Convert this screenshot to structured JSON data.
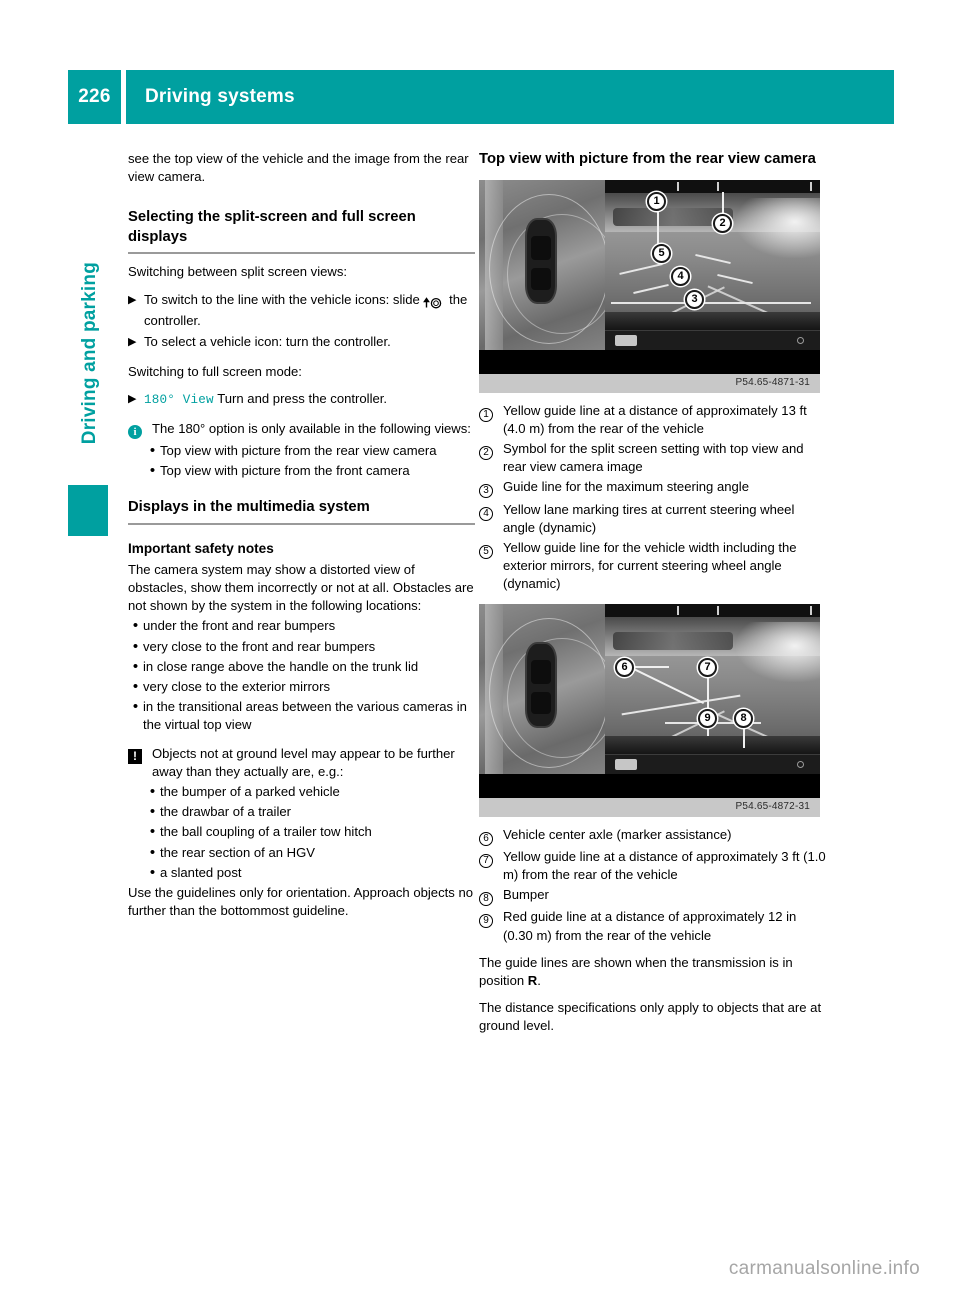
{
  "header": {
    "page_number": "226",
    "title": "Driving systems"
  },
  "side_tab": {
    "chapter_label": "Driving and parking"
  },
  "left_column": {
    "intro_paragraph": "see the top view of the vehicle and the image from the rear view camera.",
    "section1_heading": "Selecting the split-screen and full screen displays",
    "switching_split_label": "Switching between split screen views:",
    "steps": [
      {
        "marker": "▶",
        "text_before": "To switch to the line with the vehicle icons: slide",
        "glyph": "slide-controller-icon",
        "text_after": "the controller."
      },
      {
        "marker": "▶",
        "text": "To select a vehicle icon: turn the controller."
      }
    ],
    "switching_full_label": "Switching to full screen mode:",
    "step_fullscreen": {
      "marker": "▶",
      "token": "180° View",
      "text": "Turn and press the controller."
    },
    "info_note": {
      "icon": "info-icon",
      "icon_glyph": "i",
      "text": "The 180° option is only available in the following views:",
      "items": [
        "Top view with picture from the rear view camera",
        "Top view with picture from the front camera"
      ]
    },
    "section2_heading": "Displays in the multimedia system",
    "safety_heading": "Important safety notes",
    "safety_paragraph": "The camera system may show a distorted view of obstacles, show them incorrectly or not at all. Obstacles are not shown by the system in the following locations:",
    "safety_items": [
      "under the front and rear bumpers",
      "very close to the front and rear bumpers",
      "in close range above the handle on the trunk lid",
      "very close to the exterior mirrors",
      "in the transitional areas between the various cameras in the virtual top view"
    ],
    "warning_note": {
      "icon": "warning-icon",
      "icon_glyph": "!",
      "text": "Objects not at ground level may appear to be further away than they actually are, e.g.:",
      "items": [
        "the bumper of a parked vehicle",
        "the drawbar of a trailer",
        "the ball coupling of a trailer tow hitch",
        "the rear section of an HGV",
        "a slanted post"
      ]
    },
    "closing_paragraph": "Use the guidelines only for orientation. Approach objects no further than the bottommost guideline."
  },
  "right_column": {
    "section_heading": "Top view with picture from the rear view camera",
    "figure1": {
      "caption": "P54.65-4871-31",
      "callouts": [
        "1",
        "2",
        "3",
        "4",
        "5"
      ]
    },
    "legend1": [
      {
        "num": "1",
        "text": "Yellow guide line at a distance of approximately 13 ft (4.0 m) from the rear of the vehicle"
      },
      {
        "num": "2",
        "text": "Symbol for the split screen setting with top view and rear view camera image"
      },
      {
        "num": "3",
        "text": "Guide line for the maximum steering angle"
      },
      {
        "num": "4",
        "text": "Yellow lane marking tires at current steering wheel angle (dynamic)"
      },
      {
        "num": "5",
        "text": "Yellow guide line for the vehicle width including the exterior mirrors, for current steering wheel angle (dynamic)"
      }
    ],
    "figure2": {
      "caption": "P54.65-4872-31",
      "callouts": [
        "6",
        "7",
        "8",
        "9"
      ]
    },
    "legend2": [
      {
        "num": "6",
        "text": "Vehicle center axle (marker assistance)"
      },
      {
        "num": "7",
        "text": "Yellow guide line at a distance of approximately 3 ft (1.0 m) from the rear of the vehicle"
      },
      {
        "num": "8",
        "text": "Bumper"
      },
      {
        "num": "9",
        "text": "Red guide line at a distance of approximately 12 in (0.30 m) from the rear of the vehicle"
      }
    ],
    "closing1_before": "The guide lines are shown when the transmission is in position ",
    "closing1_bold": "R",
    "closing1_after": ".",
    "closing2": "The distance specifications only apply to objects that are at ground level."
  },
  "footer": {
    "watermark": "carmanualsonline.info"
  },
  "colors": {
    "teal": "#00a0a0",
    "rule_gray": "#9a9a9a",
    "caption_strip": "#c8c8c8",
    "watermark_gray": "#a6a6a6"
  }
}
